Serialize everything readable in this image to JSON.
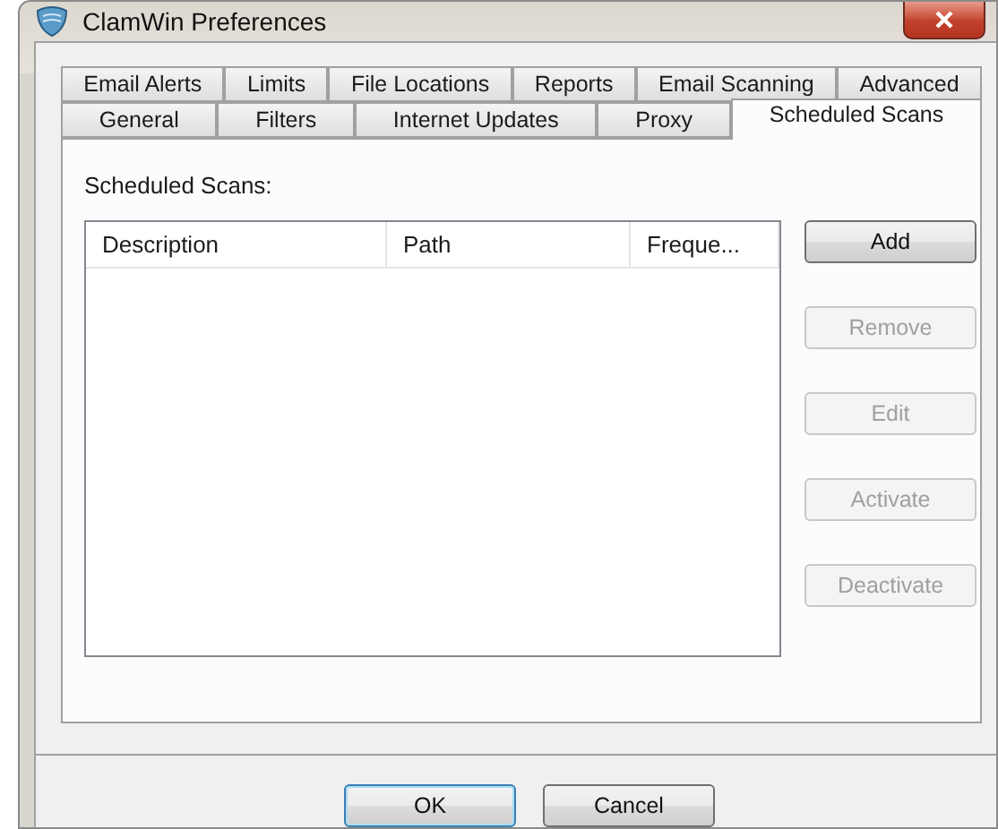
{
  "window": {
    "title": "ClamWin Preferences"
  },
  "tab_rows": [
    [
      {
        "label": "Email Alerts",
        "selected": false
      },
      {
        "label": "Limits",
        "selected": false
      },
      {
        "label": "File Locations",
        "selected": false
      },
      {
        "label": "Reports",
        "selected": false
      },
      {
        "label": "Email Scanning",
        "selected": false
      },
      {
        "label": "Advanced",
        "selected": false
      }
    ],
    [
      {
        "label": "General",
        "selected": false
      },
      {
        "label": "Filters",
        "selected": false
      },
      {
        "label": "Internet Updates",
        "selected": false
      },
      {
        "label": "Proxy",
        "selected": false
      },
      {
        "label": "Scheduled Scans",
        "selected": true
      }
    ]
  ],
  "section_label": "Scheduled Scans:",
  "table": {
    "columns": [
      "Description",
      "Path",
      "Freque..."
    ]
  },
  "side_buttons": [
    {
      "label": "Add",
      "disabled": false
    },
    {
      "label": "Remove",
      "disabled": true
    },
    {
      "label": "Edit",
      "disabled": true
    },
    {
      "label": "Activate",
      "disabled": true
    },
    {
      "label": "Deactivate",
      "disabled": true
    }
  ],
  "footer_buttons": [
    {
      "label": "OK",
      "default": true
    },
    {
      "label": "Cancel",
      "default": false
    }
  ]
}
